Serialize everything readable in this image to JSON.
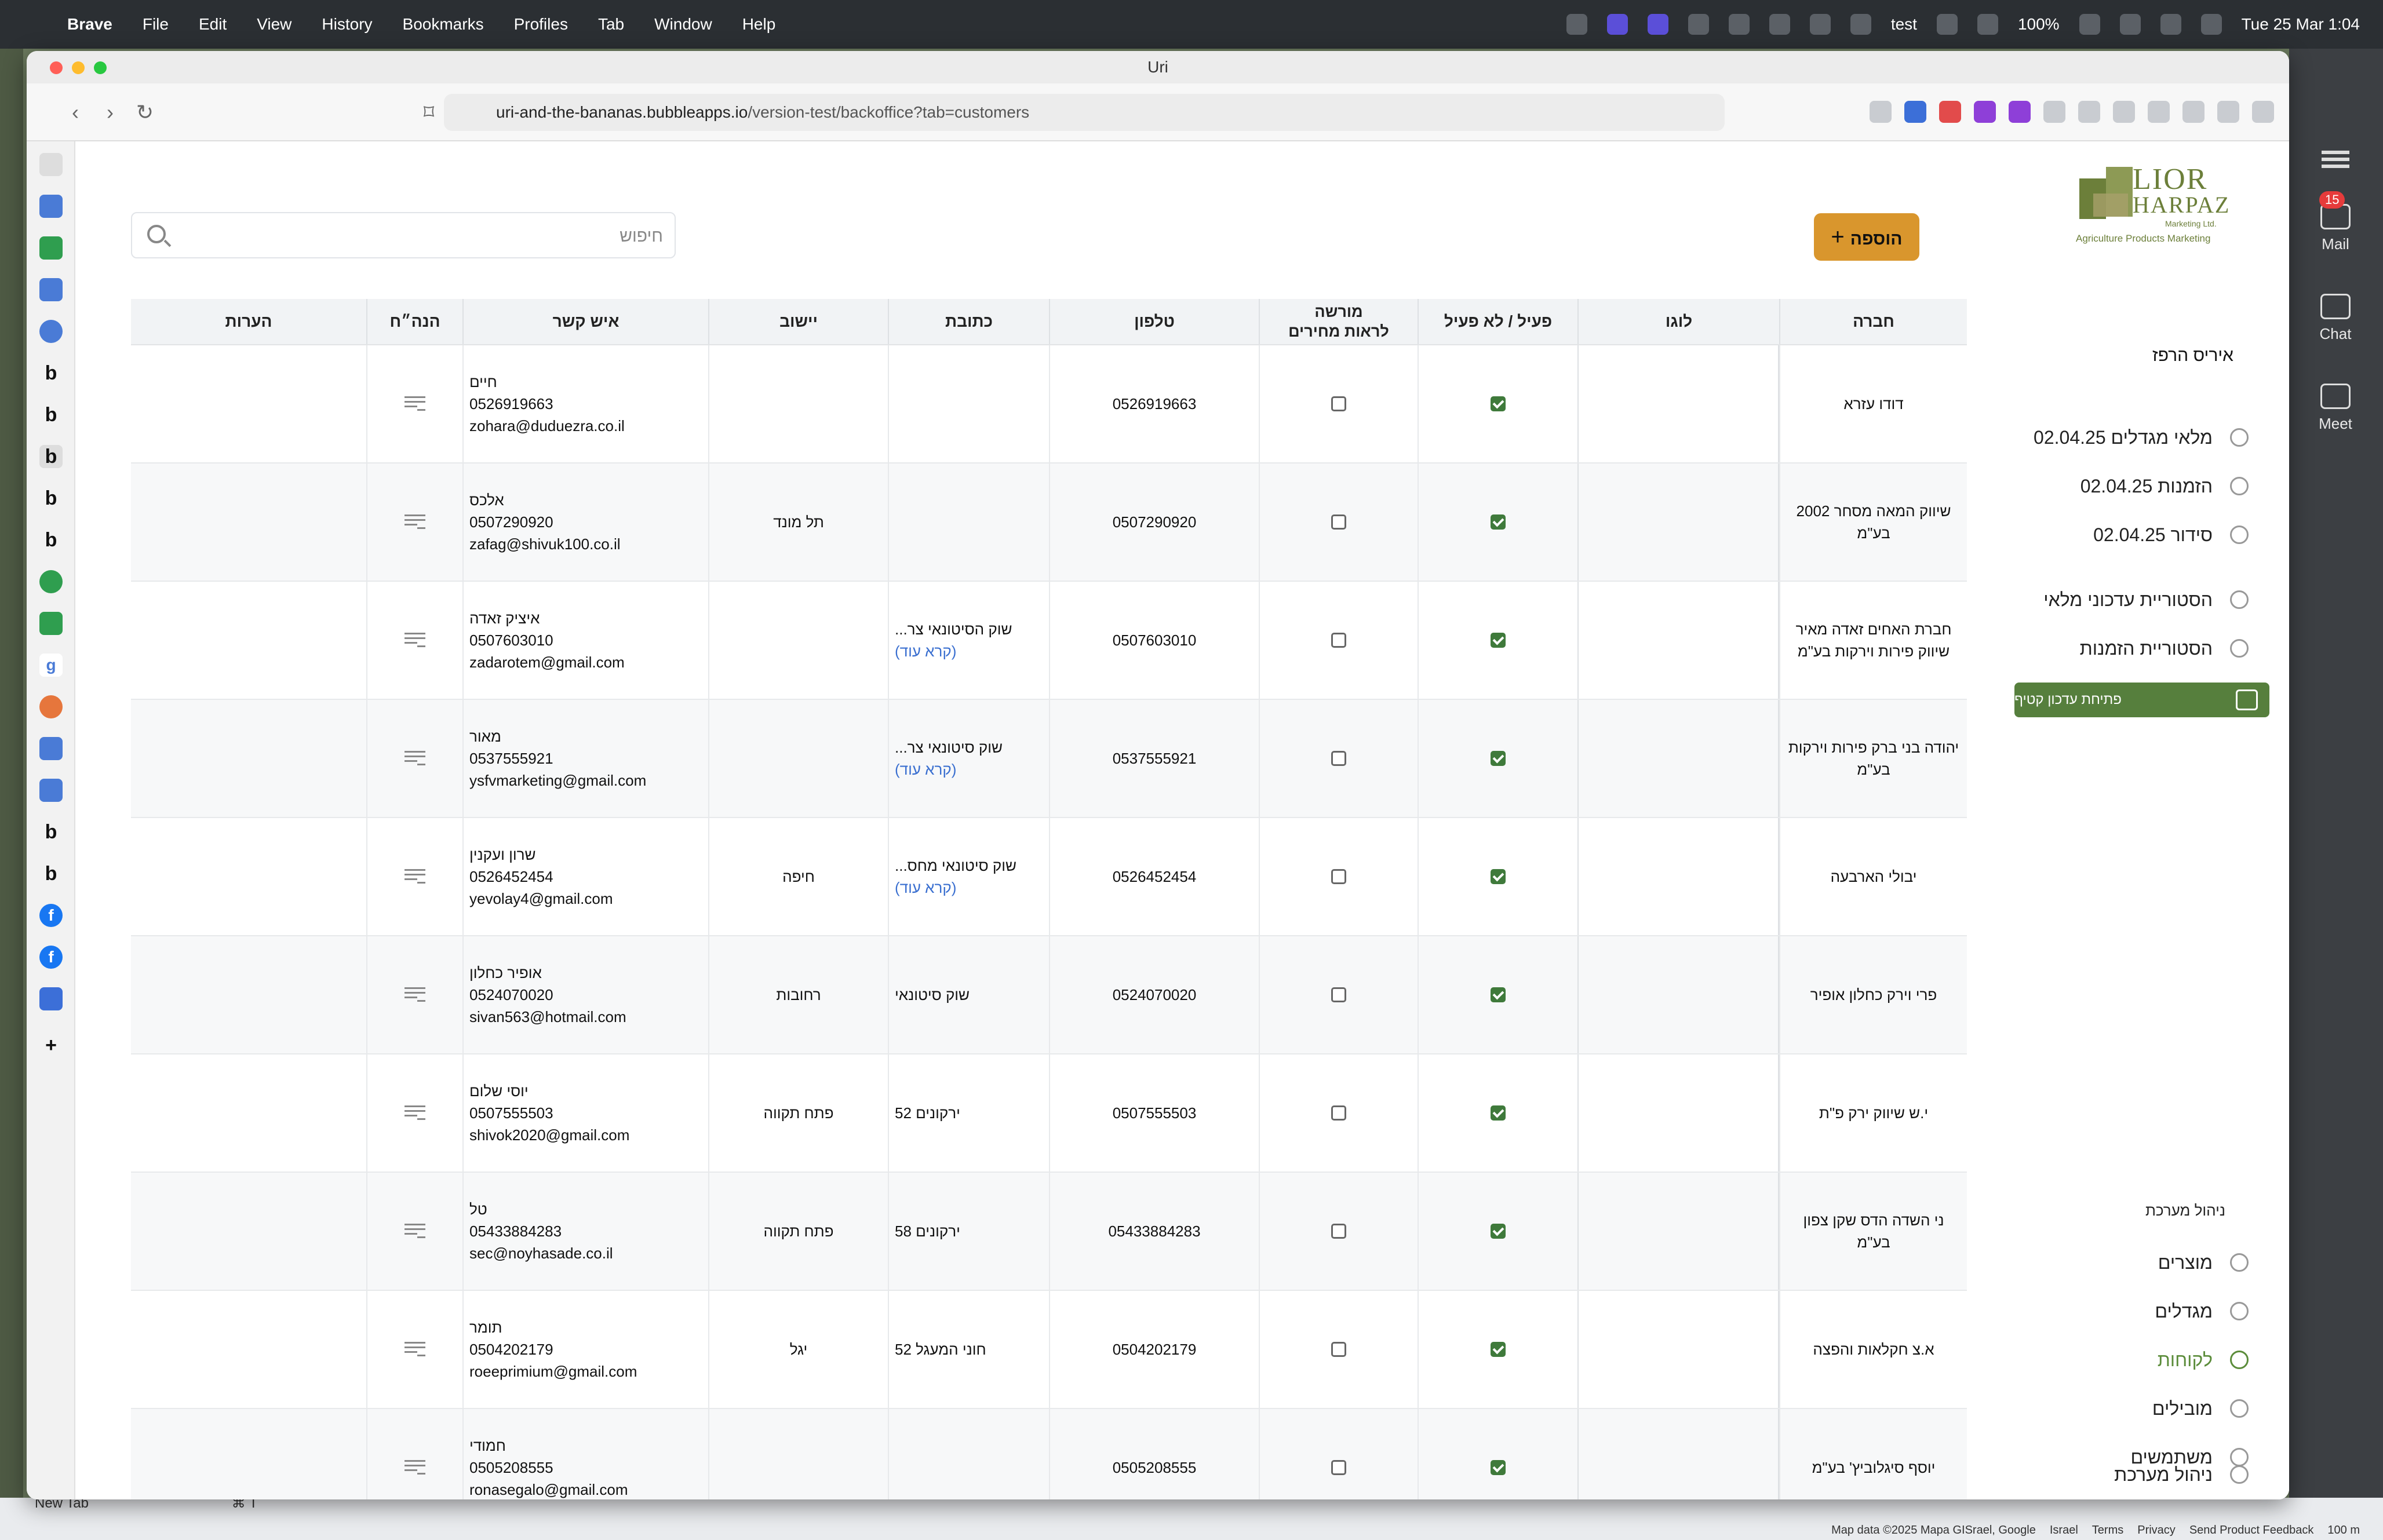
{
  "menubar": {
    "app": "Brave",
    "items": [
      "File",
      "Edit",
      "View",
      "History",
      "Bookmarks",
      "Profiles",
      "Tab",
      "Window",
      "Help"
    ],
    "status_user": "test",
    "battery": "100%",
    "datetime": "Tue 25 Mar  1:04"
  },
  "window": {
    "title": "Uri",
    "url_domain": "uri-and-the-bananas.bubbleapps.io",
    "url_path": "/version-test/backoffice?tab=customers"
  },
  "tab_sidebar": {
    "new_tab": "New Tab",
    "shortcut": "⌘ T"
  },
  "right_sidebar": {
    "items": [
      {
        "label": "Mail",
        "badge": "15"
      },
      {
        "label": "Chat"
      },
      {
        "label": "Meet"
      }
    ]
  },
  "page": {
    "search_placeholder": "חיפוש",
    "add_button": "הוספה",
    "columns": {
      "company": "חברה",
      "logo": "לוגו",
      "active": "פעיל / לא פעיל",
      "pricing_line1": "מורשה",
      "pricing_line2": "לראות מחירים",
      "phone": "טלפון",
      "address": "כתובת",
      "city": "יישוב",
      "contact": "איש קשר",
      "accounting": "הנה״ח",
      "notes": "הערות"
    },
    "rows": [
      {
        "company": "דודו עזרא",
        "phone": "0526919663",
        "address": "",
        "address_more": "",
        "city": "",
        "contact_name": "חיים",
        "contact_phone": "0526919663",
        "contact_email": "zohara@duduezra.co.il"
      },
      {
        "company": "שיווק המאה מסחר 2002 בע\"מ",
        "phone": "0507290920",
        "address": "",
        "address_more": "",
        "city": "תל מונד",
        "contact_name": "אלכס",
        "contact_phone": "0507290920",
        "contact_email": "zafag@shivuk100.co.il"
      },
      {
        "company": "חברת האחים זאדה מאיר שיווק פירות וירקות בע\"מ",
        "phone": "0507603010",
        "address": "שוק הסיטונאי צר...",
        "address_more": "(קרא עוד)",
        "city": "",
        "contact_name": "איציק זאדה",
        "contact_phone": "0507603010",
        "contact_email": "zadarotem@gmail.com"
      },
      {
        "company": "יהודה בני ברק פירות וירקות בע\"מ",
        "phone": "0537555921",
        "address": "שוק סיטונאי צר...",
        "address_more": "(קרא עוד)",
        "city": "",
        "contact_name": "מאור",
        "contact_phone": "0537555921",
        "contact_email": "ysfvmarketing@gmail.com"
      },
      {
        "company": "יבולי הארבעה",
        "phone": "0526452454",
        "address": "שוק סיטונאי מחס...",
        "address_more": "(קרא עוד)",
        "city": "חיפה",
        "contact_name": "שרון ועקנין",
        "contact_phone": "0526452454",
        "contact_email": "yevolay4@gmail.com"
      },
      {
        "company": "פרי וירק כחלון אופיר",
        "phone": "0524070020",
        "address": "שוק סיטונאי",
        "address_more": "",
        "city": "רחובות",
        "contact_name": "אופיר כחלון",
        "contact_phone": "0524070020",
        "contact_email": "sivan563@hotmail.com"
      },
      {
        "company": "י.ש שיווק ירק פ\"ת",
        "phone": "0507555503",
        "address": "ירקונים 52",
        "address_more": "",
        "city": "פתח תקווה",
        "contact_name": "יוסי שלום",
        "contact_phone": "0507555503",
        "contact_email": "shivok2020@gmail.com"
      },
      {
        "company": "ני השדה הדס שקן צפון בע\"מ",
        "phone": "05433884283",
        "address": "ירקונים 58",
        "address_more": "",
        "city": "פתח תקווה",
        "contact_name": "טל",
        "contact_phone": "05433884283",
        "contact_email": "sec@noyhasade.co.il"
      },
      {
        "company": "א.צ חקלאות והפצה",
        "phone": "0504202179",
        "address": "חוני המעגל 52",
        "address_more": "",
        "city": "יגל",
        "contact_name": "תומר",
        "contact_phone": "0504202179",
        "contact_email": "roeeprimium@gmail.com"
      },
      {
        "company": "יוסף סיגלוביץ' בע\"מ",
        "phone": "0505208555",
        "address": "",
        "address_more": "",
        "city": "",
        "contact_name": "חמודי",
        "contact_phone": "0505208555",
        "contact_email": "ronasegalo@gmail.com"
      }
    ]
  },
  "nav": {
    "brand_line1": "LIOR",
    "brand_line2": "HARPAZ",
    "brand_sub": "Marketing Ltd.",
    "brand_tagline": "Agriculture Products Marketing",
    "user_name": "איריס הרפז",
    "items": [
      {
        "label": "מלאי מגדלים 02.04.25"
      },
      {
        "label": "הזמנות 02.04.25"
      },
      {
        "label": "סידור 02.04.25"
      },
      {
        "label": "הסטוריית עדכוני מלאי"
      },
      {
        "label": "הסטוריית הזמנות"
      }
    ],
    "green_button": "פתיחת עדכון קטיף",
    "system_label": "ניהול מערכת",
    "system_items": [
      {
        "label": "מוצרים"
      },
      {
        "label": "מגדלים"
      },
      {
        "label": "לקוחות"
      },
      {
        "label": "מובילים"
      },
      {
        "label": "משתמשים"
      },
      {
        "label": "ניהול מערכת"
      }
    ]
  },
  "map_attribution": [
    "Map data ©2025 Mapa GISrael, Google",
    "Israel",
    "Terms",
    "Privacy",
    "Send Product Feedback",
    "100 m"
  ]
}
